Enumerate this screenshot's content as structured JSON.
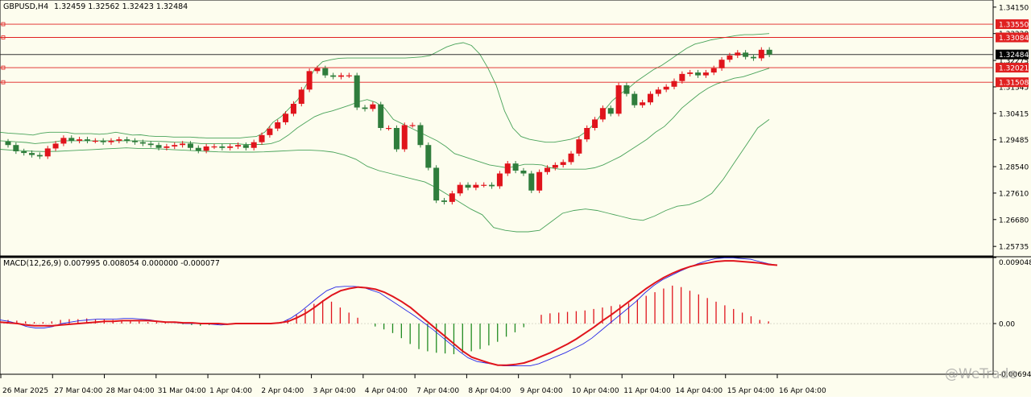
{
  "header": {
    "symbol": "GBPUSD,H4",
    "values": "1.32459 1.32562 1.32423 1.32484"
  },
  "macd_header": "MACD(12,26,9) 0.007995 0.008054 0.000000 -0.000077",
  "watermark": "@WeTrade",
  "colors": {
    "bg": "#fdfdee",
    "bull": "#e0141c",
    "bear": "#2f7d3c",
    "band": "#1c8c34",
    "hline": "#e02020",
    "macd_line": "#2828e6",
    "signal_line": "#e0141c",
    "hist_pos": "#e0141c",
    "hist_neg": "#228b22"
  },
  "price_axis": {
    "labels": [
      "1.34150",
      "1.33220",
      "1.32275",
      "1.31345",
      "1.30415",
      "1.29485",
      "1.28540",
      "1.27610",
      "1.26680",
      "1.25735"
    ],
    "ylim": [
      1.254,
      1.344
    ]
  },
  "price_tags": [
    {
      "label": "1.33550",
      "style": "red-box"
    },
    {
      "label": "1.33084",
      "style": "red-box"
    },
    {
      "label": "1.32484",
      "style": "black-box"
    },
    {
      "label": "1.32021",
      "style": "red-box"
    },
    {
      "label": "1.31508",
      "style": "red-box"
    }
  ],
  "macd_axis": {
    "labels": [
      "0.009048",
      "0.00",
      "-0.006946"
    ]
  },
  "time_axis": [
    "26 Mar 2025",
    "27 Mar 04:00",
    "28 Mar 04:00",
    "31 Mar 04:00",
    "1 Apr 04:00",
    "2 Apr 04:00",
    "3 Apr 04:00",
    "4 Apr 04:00",
    "7 Apr 04:00",
    "8 Apr 04:00",
    "9 Apr 04:00",
    "10 Apr 04:00",
    "11 Apr 04:00",
    "14 Apr 04:00",
    "15 Apr 04:00",
    "16 Apr 04:00"
  ],
  "chart_data": {
    "type": "candlestick",
    "series": [
      {
        "name": "GBPUSD,H4",
        "close": [
          1.293,
          1.2908,
          1.2902,
          1.2895,
          1.289,
          1.2918,
          1.2935,
          1.2955,
          1.2945,
          1.295,
          1.2945,
          1.2945,
          1.294,
          1.2945,
          1.295,
          1.2945,
          1.294,
          1.2935,
          1.293,
          1.292,
          1.2925,
          1.293,
          1.2935,
          1.292,
          1.291,
          1.2925,
          1.2925,
          1.292,
          1.2925,
          1.293,
          1.292,
          1.294,
          1.2965,
          1.2988,
          1.301,
          1.304,
          1.3075,
          1.3125,
          1.319,
          1.32,
          1.3175,
          1.317,
          1.3175,
          1.3175,
          1.3062,
          1.3057,
          1.3073,
          1.299,
          1.299,
          1.2915,
          1.3,
          1.3,
          1.293,
          1.285,
          1.2735,
          1.273,
          1.276,
          1.279,
          1.278,
          1.279,
          1.279,
          1.2785,
          1.283,
          1.2865,
          1.284,
          1.283,
          1.277,
          1.2835,
          1.285,
          1.286,
          1.287,
          1.29,
          1.295,
          1.299,
          1.302,
          1.306,
          1.304,
          1.314,
          1.311,
          1.307,
          1.308,
          1.311,
          1.3125,
          1.3135,
          1.3155,
          1.318,
          1.3185,
          1.3175,
          1.3185,
          1.32,
          1.323,
          1.3245,
          1.3255,
          1.324,
          1.3235,
          1.3265,
          1.3248
        ]
      },
      {
        "name": "Bollinger upper",
        "values": [
          1.2975,
          1.2972,
          1.297,
          1.2968,
          1.2965,
          1.2972,
          1.2975,
          1.2975,
          1.2975,
          1.297,
          1.297,
          1.297,
          1.2968,
          1.297,
          1.2975,
          1.297,
          1.2965,
          1.2966,
          1.2962,
          1.296,
          1.296,
          1.2958,
          1.2958,
          1.2958,
          1.2956,
          1.2955,
          1.2955,
          1.2955,
          1.2955,
          1.2955,
          1.2958,
          1.296,
          1.2975,
          1.301,
          1.303,
          1.306,
          1.309,
          1.314,
          1.3195,
          1.3223,
          1.323,
          1.3235,
          1.3236,
          1.3236,
          1.3236,
          1.3236,
          1.3236,
          1.3236,
          1.3236,
          1.3236,
          1.3238,
          1.324,
          1.3245,
          1.326,
          1.3275,
          1.3285,
          1.329,
          1.328,
          1.325,
          1.32,
          1.314,
          1.305,
          1.299,
          1.296,
          1.295,
          1.2945,
          1.294,
          1.294,
          1.2945,
          1.295,
          1.296,
          1.298,
          1.301,
          1.305,
          1.3085,
          1.311,
          1.313,
          1.3155,
          1.3175,
          1.3195,
          1.321,
          1.323,
          1.325,
          1.327,
          1.3285,
          1.3292,
          1.33,
          1.3305,
          1.331,
          1.3315,
          1.3318,
          1.3318,
          1.332,
          1.3322
        ]
      },
      {
        "name": "Bollinger middle",
        "values": [
          1.2945,
          1.2943,
          1.2941,
          1.2939,
          1.2935,
          1.2938,
          1.294,
          1.2945,
          1.2945,
          1.2945,
          1.2945,
          1.2945,
          1.2945,
          1.2945,
          1.2945,
          1.2945,
          1.2945,
          1.2944,
          1.2943,
          1.2942,
          1.294,
          1.294,
          1.2938,
          1.2935,
          1.2935,
          1.2935,
          1.2935,
          1.2935,
          1.2932,
          1.2932,
          1.2932,
          1.2935,
          1.2945,
          1.2965,
          1.299,
          1.301,
          1.303,
          1.3042,
          1.305,
          1.306,
          1.307,
          1.3082,
          1.309,
          1.308,
          1.306,
          1.302,
          1.3005,
          1.299,
          1.2975,
          1.296,
          1.2945,
          1.2925,
          1.29,
          1.289,
          1.288,
          1.287,
          1.286,
          1.2855,
          1.285,
          1.2855,
          1.2862,
          1.2862,
          1.286,
          1.285,
          1.2845,
          1.2845,
          1.2845,
          1.2845,
          1.285,
          1.286,
          1.2875,
          1.289,
          1.291,
          1.293,
          1.295,
          1.2975,
          1.2995,
          1.3025,
          1.306,
          1.3085,
          1.311,
          1.313,
          1.3145,
          1.3155,
          1.3165,
          1.317,
          1.318,
          1.319,
          1.32
        ]
      },
      {
        "name": "Bollinger lower",
        "values": [
          1.2915,
          1.2912,
          1.291,
          1.2908,
          1.2907,
          1.2908,
          1.291,
          1.2912,
          1.2914,
          1.2916,
          1.2918,
          1.292,
          1.2918,
          1.2918,
          1.2916,
          1.2914,
          1.2912,
          1.291,
          1.2908,
          1.2906,
          1.2905,
          1.2905,
          1.2905,
          1.2906,
          1.2908,
          1.291,
          1.2912,
          1.2912,
          1.291,
          1.2905,
          1.2895,
          1.288,
          1.2855,
          1.284,
          1.283,
          1.282,
          1.281,
          1.28,
          1.278,
          1.2755,
          1.273,
          1.2705,
          1.2685,
          1.264,
          1.263,
          1.2625,
          1.2625,
          1.263,
          1.266,
          1.269,
          1.27,
          1.2705,
          1.27,
          1.269,
          1.268,
          1.267,
          1.2665,
          1.268,
          1.27,
          1.2715,
          1.272,
          1.2735,
          1.276,
          1.281,
          1.287,
          1.293,
          1.299,
          1.302
        ]
      },
      {
        "name": "MACD",
        "values": [
          0.0005,
          0.0003,
          0.0,
          -0.0004,
          -0.0006,
          -0.0006,
          -0.0004,
          0.0,
          0.0002,
          0.0004,
          0.0005,
          0.0006,
          0.0006,
          0.0006,
          0.0007,
          0.0007,
          0.0006,
          0.0005,
          0.0003,
          0.0002,
          0.0001,
          0.0,
          0.0,
          0.0,
          -0.0001,
          -0.0002,
          -0.0001,
          0.0,
          0.0,
          0.0,
          0.0,
          0.0,
          0.0002,
          0.0008,
          0.0016,
          0.0026,
          0.0036,
          0.0045,
          0.005,
          0.0051,
          0.0051,
          0.005,
          0.0046,
          0.0042,
          0.0034,
          0.0026,
          0.0018,
          0.001,
          0.0001,
          -0.0008,
          -0.0018,
          -0.0028,
          -0.0038,
          -0.0047,
          -0.0052,
          -0.0054,
          -0.0056,
          -0.0058,
          -0.0058,
          -0.0058,
          -0.0058,
          -0.0055,
          -0.005,
          -0.0045,
          -0.004,
          -0.0034,
          -0.0028,
          -0.002,
          -0.001,
          0.0,
          0.001,
          0.002,
          0.003,
          0.0042,
          0.0052,
          0.006,
          0.0066,
          0.0072,
          0.0077,
          0.0082,
          0.0086,
          0.0089,
          0.009,
          0.009,
          0.0089,
          0.0088,
          0.0085,
          0.0082,
          0.008
        ]
      },
      {
        "name": "Signal",
        "values": [
          0.0002,
          0.0001,
          0.0,
          -0.0002,
          -0.0003,
          -0.0003,
          -0.0003,
          -0.0002,
          -0.0001,
          0.0,
          0.0001,
          0.0002,
          0.0003,
          0.0003,
          0.0004,
          0.0004,
          0.0004,
          0.0004,
          0.0003,
          0.0002,
          0.0002,
          0.0001,
          0.0001,
          0.0,
          0.0,
          0.0,
          -0.0001,
          0.0,
          0.0,
          0.0,
          0.0,
          0.0,
          0.0001,
          0.0003,
          0.0008,
          0.0014,
          0.0022,
          0.0031,
          0.0039,
          0.0045,
          0.0048,
          0.005,
          0.0049,
          0.0047,
          0.0043,
          0.0037,
          0.003,
          0.0022,
          0.0012,
          0.0002,
          -0.0008,
          -0.0018,
          -0.0028,
          -0.0038,
          -0.0046,
          -0.005,
          -0.0054,
          -0.0057,
          -0.0057,
          -0.0056,
          -0.0054,
          -0.005,
          -0.0045,
          -0.004,
          -0.0034,
          -0.0028,
          -0.0021,
          -0.0013,
          -0.0005,
          0.0004,
          0.0012,
          0.0021,
          0.003,
          0.0039,
          0.0048,
          0.0056,
          0.0063,
          0.0069,
          0.0074,
          0.0078,
          0.0081,
          0.0083,
          0.0085,
          0.0086,
          0.0086,
          0.0085,
          0.0084,
          0.0083,
          0.0081,
          0.008
        ]
      },
      {
        "name": "Histogram",
        "values": [
          0.0005,
          0.0004,
          0.0003,
          0.0002,
          0.0002,
          0.0003,
          0.0005,
          0.0006,
          0.0006,
          0.0007,
          0.0006,
          0.0006,
          0.0005,
          0.0004,
          0.0004,
          0.0003,
          0.0002,
          0.0002,
          0.0001,
          0.0,
          -0.0001,
          -0.0002,
          -0.0003,
          -0.0002,
          -0.0002,
          -0.0001,
          -0.0001,
          -0.0001,
          -0.0001,
          0.0,
          0.0,
          0.0001,
          0.0005,
          0.0012,
          0.002,
          0.0027,
          0.0032,
          0.003,
          0.0022,
          0.0015,
          0.0008,
          0.0,
          -0.0004,
          -0.0008,
          -0.0013,
          -0.002,
          -0.0028,
          -0.0035,
          -0.0038,
          -0.004,
          -0.0041,
          -0.0042,
          -0.004,
          -0.0038,
          -0.0035,
          -0.003,
          -0.0025,
          -0.0018,
          -0.0012,
          -0.0005,
          0.0,
          0.0012,
          0.0014,
          0.0015,
          0.0016,
          0.0017,
          0.0018,
          0.002,
          0.0022,
          0.0024,
          0.0026,
          0.0028,
          0.0033,
          0.0038,
          0.0043,
          0.0048,
          0.0052,
          0.005,
          0.0045,
          0.004,
          0.0035,
          0.003,
          0.0025,
          0.002,
          0.0015,
          0.001,
          0.0005,
          0.0003
        ]
      }
    ],
    "ylim": [
      1.254,
      1.344
    ],
    "macd_ylim": [
      -0.006946,
      0.009048
    ],
    "xlabel": "",
    "ylabel": "",
    "grid": false
  }
}
